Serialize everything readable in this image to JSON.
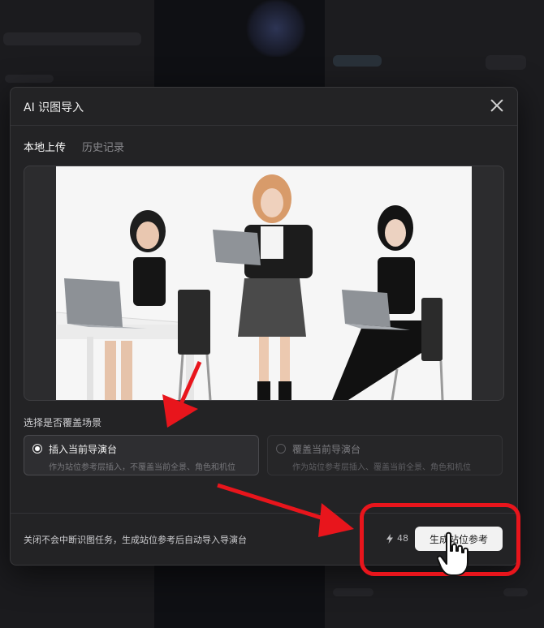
{
  "modal": {
    "title": "AI 识图导入",
    "tabs": [
      {
        "label": "本地上传",
        "active": true
      },
      {
        "label": "历史记录",
        "active": false
      }
    ]
  },
  "scene": {
    "section_label": "选择是否覆盖场景",
    "options": [
      {
        "title": "插入当前导演台",
        "description": "作为站位参考层插入，不覆盖当前全景、角色和机位",
        "selected": true
      },
      {
        "title": "覆盖当前导演台",
        "description": "作为站位参考层插入、覆盖当前全景、角色和机位",
        "selected": false
      }
    ]
  },
  "footer": {
    "note": "关闭不会中断识图任务，生成站位参考后自动导入导演台",
    "credits": "48",
    "generate_label": "生成站位参考"
  },
  "colors": {
    "annotation": "#e8151c",
    "modal_bg": "#232325",
    "primary_button": "#f2f2f2"
  }
}
